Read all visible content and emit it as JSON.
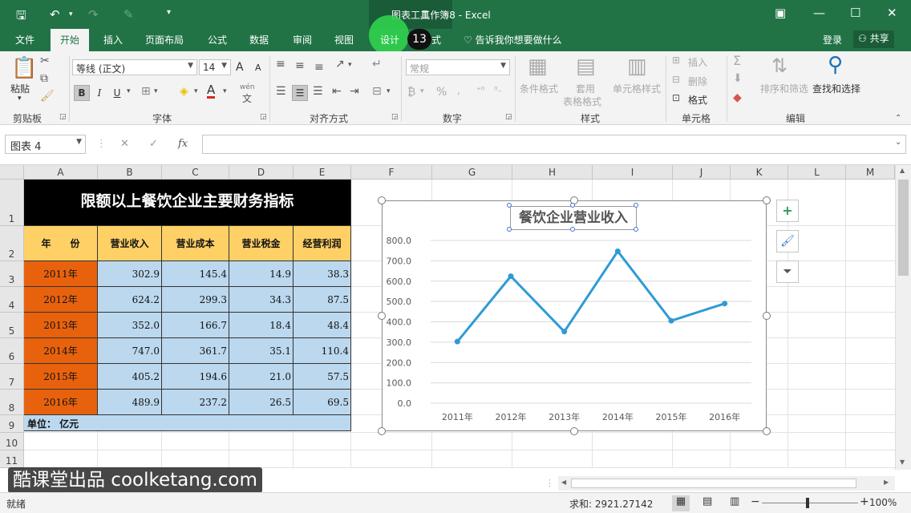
{
  "app": {
    "doc_title": "工作簿8 - Excel",
    "context_tools": "图表工具",
    "sign_in": "登录",
    "share": "共享"
  },
  "tabs": {
    "file": "文件",
    "home": "开始",
    "insert": "插入",
    "layout": "页面布局",
    "formulas": "公式",
    "data": "数据",
    "review": "审阅",
    "view": "视图",
    "design": "设计",
    "format_tail": "式",
    "badge": "13",
    "tell_me": "告诉我你想要做什么"
  },
  "ribbon": {
    "paste": "粘贴",
    "clipboard": "剪贴板",
    "font_name": "等线 (正文)",
    "font_size": "14",
    "font_group": "字体",
    "align_group": "对齐方式",
    "number_format": "常规",
    "number_group": "数字",
    "percent": "%",
    "cond_format": "条件格式",
    "table_format_1": "套用",
    "table_format_2": "表格格式",
    "cell_style": "单元格样式",
    "styles_group": "样式",
    "insert": "插入",
    "delete": "删除",
    "format": "格式",
    "cells_group": "单元格",
    "sort_filter": "排序和筛选",
    "find_select": "查找和选择",
    "edit_group": "编辑",
    "bold": "B",
    "italic": "I",
    "underline": "U",
    "font_color_letter": "A",
    "grow_a": "A",
    "shrink_a": "A",
    "wen": "wén"
  },
  "formula_bar": {
    "name_box": "图表 4",
    "fx": "fx",
    "cancel": "✕",
    "enter": "✓",
    "value": ""
  },
  "columns": [
    "A",
    "B",
    "C",
    "D",
    "E",
    "F",
    "G",
    "H",
    "I",
    "J",
    "K",
    "L",
    "M"
  ],
  "rows": [
    "1",
    "2",
    "3",
    "4",
    "5",
    "6",
    "7",
    "8",
    "9",
    "10",
    "11"
  ],
  "table": {
    "title": "限额以上餐饮企业主要财务指标",
    "headers": [
      "年　　份",
      "营业收入",
      "营业成本",
      "营业税金",
      "经营利润"
    ],
    "rows": [
      [
        "2011年",
        "302.9",
        "145.4",
        "14.9",
        "38.3"
      ],
      [
        "2012年",
        "624.2",
        "299.3",
        "34.3",
        "87.5"
      ],
      [
        "2013年",
        "352.0",
        "166.7",
        "18.4",
        "48.4"
      ],
      [
        "2014年",
        "747.0",
        "361.7",
        "35.1",
        "110.4"
      ],
      [
        "2015年",
        "405.2",
        "194.6",
        "21.0",
        "57.5"
      ],
      [
        "2016年",
        "489.9",
        "237.2",
        "26.5",
        "69.5"
      ]
    ],
    "unit": "单位：  亿元"
  },
  "chart_data": {
    "type": "line",
    "title": "餐饮企业营业收入",
    "categories": [
      "2011年",
      "2012年",
      "2013年",
      "2014年",
      "2015年",
      "2016年"
    ],
    "series": [
      {
        "values": [
          302.9,
          624.2,
          352.0,
          747.0,
          405.2,
          489.9
        ]
      }
    ],
    "ylim": [
      0,
      800
    ],
    "yticks": [
      "0.0",
      "100.0",
      "200.0",
      "300.0",
      "400.0",
      "500.0",
      "600.0",
      "700.0",
      "800.0"
    ],
    "grid": true,
    "color": "#2e9bd6"
  },
  "chart_buttons": {
    "add": "+",
    "style": "🖌",
    "filter": "⏷"
  },
  "status": {
    "ready": "就绪",
    "sum": "求和: 2921.27142",
    "zoom": "100%",
    "minus": "−",
    "plus": "+"
  },
  "watermark": "酷课堂出品 coolketang.com",
  "colors": {
    "excel_green": "#217346",
    "title_black": "#000000",
    "header_yellow": "#ffd066",
    "year_orange": "#e8620e",
    "value_blue": "#bcd8ee",
    "line_blue": "#2e9bd6"
  }
}
